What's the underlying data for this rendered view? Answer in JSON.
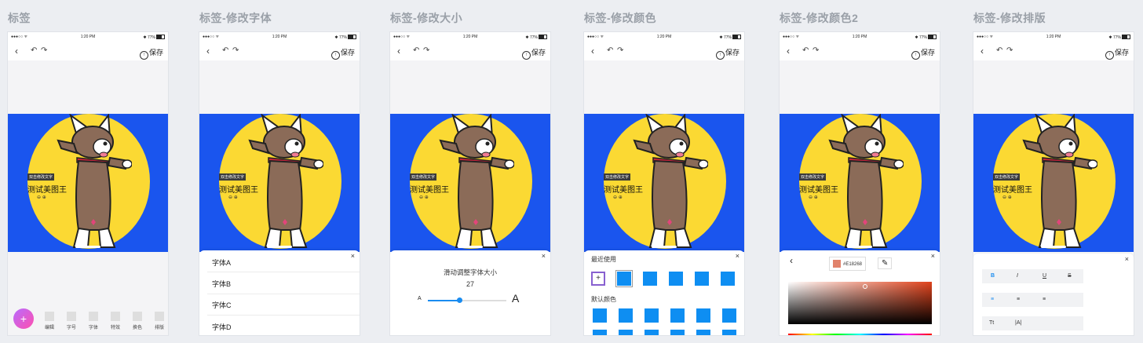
{
  "boards": [
    {
      "title": "标签"
    },
    {
      "title": "标签-修改字体"
    },
    {
      "title": "标签-修改大小"
    },
    {
      "title": "标签-修改颜色"
    },
    {
      "title": "标签-修改颜色2"
    },
    {
      "title": "标签-修改排版"
    }
  ],
  "status_bar": {
    "carrier": "●●●○○ ᯤ",
    "time": "1:20 PM",
    "battery": "✱ 77%"
  },
  "nav": {
    "back_icon": "‹",
    "undo_icon": "↶",
    "redo_icon": "↷",
    "save_label": "保存"
  },
  "sticker": {
    "tag": "双击修改文字",
    "text": "测试美图王",
    "controls": "⊖ ⊕"
  },
  "toolbar": {
    "add_icon": "+",
    "items": [
      {
        "label": "编辑"
      },
      {
        "label": "字号"
      },
      {
        "label": "字体"
      },
      {
        "label": "特效"
      },
      {
        "label": "换色"
      },
      {
        "label": "排版"
      }
    ]
  },
  "font_sheet": {
    "fonts": [
      "字体A",
      "字体B",
      "字体C",
      "字体D"
    ],
    "close_icon": "×"
  },
  "size_sheet": {
    "title": "滑动调整字体大小",
    "value": "27",
    "min_label": "A",
    "max_label": "A",
    "slider_fraction": 0.4
  },
  "color_sheet": {
    "recent_label": "最近使用",
    "default_label": "默认颜色",
    "add_icon": "+",
    "swatch_color": "#0e8ef2"
  },
  "color_sheet2": {
    "back_icon": "‹",
    "hex": "#E18268",
    "eyedropper_icon": "✎"
  },
  "layout_sheet": {
    "style_buttons": [
      "B",
      "I",
      "U",
      "S"
    ],
    "align_buttons": [
      "≡",
      "≡",
      "≡"
    ],
    "direction_buttons": [
      "Tt",
      "|A|"
    ]
  },
  "colors": {
    "accent": "#1a8cf0",
    "canvas_bg": "#1a55ee",
    "sun": "#fbd933"
  }
}
